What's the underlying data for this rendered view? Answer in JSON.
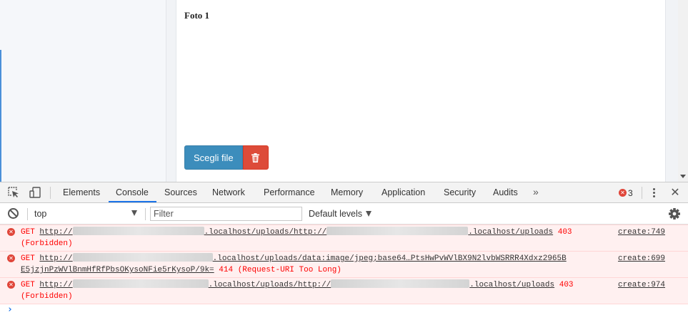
{
  "page": {
    "section_title": "Foto 1",
    "choose_file_label": "Scegli file",
    "delete_icon": "trash-icon"
  },
  "devtools": {
    "tabs": [
      {
        "label": "Elements"
      },
      {
        "label": "Console",
        "active": true
      },
      {
        "label": "Sources"
      },
      {
        "label": "Network"
      },
      {
        "label": "Performance"
      },
      {
        "label": "Memory"
      },
      {
        "label": "Application"
      },
      {
        "label": "Security"
      },
      {
        "label": "Audits"
      }
    ],
    "more_tabs": "»",
    "error_count": "3",
    "close_glyph": "✕",
    "filterbar": {
      "context": "top",
      "filter_placeholder": "Filter",
      "levels": "Default levels"
    },
    "messages": [
      {
        "method": "GET",
        "url_prefix": "http://",
        "url_host_suffix": ".localhost/uploads/http://",
        "url_tail": ".localhost/uploads",
        "status": "403",
        "status_text": "(Forbidden)",
        "source": "create:749"
      },
      {
        "method": "GET",
        "url_prefix": "http://",
        "url_host_suffix": ".localhost/uploads/data:image/jpeg;base64…PtsHwPvWVlBX9N2lvbWSRRR4Xdxz2965B",
        "url_tail": "E5jzjnPzWVlBnmHfRfPbsOKysoNFie5rKysoP/9k=",
        "status": "414",
        "status_text": "(Request-URI Too Long)",
        "source": "create:699"
      },
      {
        "method": "GET",
        "url_prefix": "http://",
        "url_host_suffix": ".localhost/uploads/http://",
        "url_tail": ".localhost/uploads",
        "status": "403",
        "status_text": "(Forbidden)",
        "source": "create:974"
      }
    ],
    "prompt_glyph": "›"
  },
  "colors": {
    "primary_button": "#3c8dbc",
    "danger_button": "#dd4b39",
    "error_red": "#ff0000",
    "error_bg": "#fff0f0",
    "active_tab_underline": "#1a73e8"
  }
}
